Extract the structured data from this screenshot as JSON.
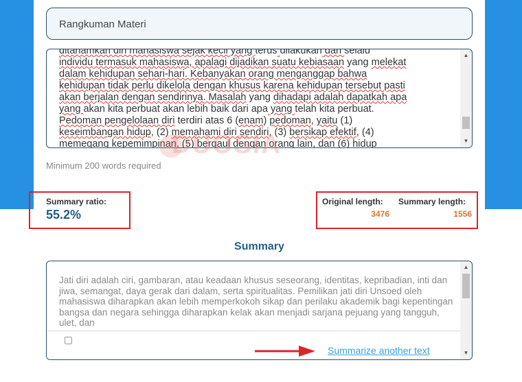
{
  "title_input": {
    "value": "Rangkuman Materi"
  },
  "original_text": {
    "lines": [
      [
        "ditanamkan diri mahasiswa sejak kecil yang ",
        "terus",
        " ",
        "dilakukan",
        " dan ",
        "selalu"
      ],
      [
        "individu termasuk mahasiswa, apalagi dijadikan suatu kebiasaan",
        " yang ",
        "melekat"
      ],
      [
        "dalam kehidupan sehari-hari. Kebanyakan orang menganggap bahwa"
      ],
      [
        "kehidupan tidak perlu dikelola dengan khusus karena kehidupan tersebut pasti"
      ],
      [
        "akan berjalan dengan sendirinya. Masalah",
        " yang ",
        "dihadapi adalah dapatkah apa"
      ],
      [
        "yang ",
        "akan kita perbuat akan lebih baik dari apa",
        " yang ",
        "telah kita perbuat."
      ],
      [
        "Pedoman pengelolaan diri",
        " terdiri atas 6 (",
        "enam",
        ") ",
        "pedoman",
        ", ",
        "yaitu",
        " (1)"
      ],
      [
        "keseimbangan hidup",
        ", (2) ",
        "memahami diri sendiri",
        ", (3) ",
        "bersikap efektif",
        ", (4)"
      ],
      [
        "memegang kepemimpinan",
        ", (5) ",
        "bergaul dengan orang lain",
        ", dan (6) ",
        "hidup"
      ]
    ]
  },
  "hint": "Minimum 200 words required",
  "watermark": "DUOSIA",
  "stats": {
    "ratio_label": "Summary ratio:",
    "ratio_value": "55.2%",
    "original_label": "Original length:",
    "original_value": "3476",
    "summary_label": "Summary length:",
    "summary_value": "1556"
  },
  "summary": {
    "title": "Summary",
    "text": "Jati diri adalah ciri, gambaran, atau keadaan khusus seseorang, identitas, kepribadian, inti dan jiwa, semangat, daya gerak dari dalam, serta spiritualitas. Pemilikan jati diri Unsoed oleh mahasiswa diharapkan akan lebih memperkokoh sikap dan perilaku akademik bagi kepentingan bangsa dan negara sehingga diharapkan kelak akan menjadi sarjana pejuang yang tangguh, ulet, dan",
    "another_link": "Summarize another text"
  },
  "colors": {
    "accent_blue": "#2690e2",
    "highlight_red": "#d8262c",
    "value_orange": "#e07030",
    "title_blue": "#1f5f86"
  },
  "icons": [
    "scroll-up-icon",
    "scroll-down-icon",
    "red-arrow-icon"
  ]
}
